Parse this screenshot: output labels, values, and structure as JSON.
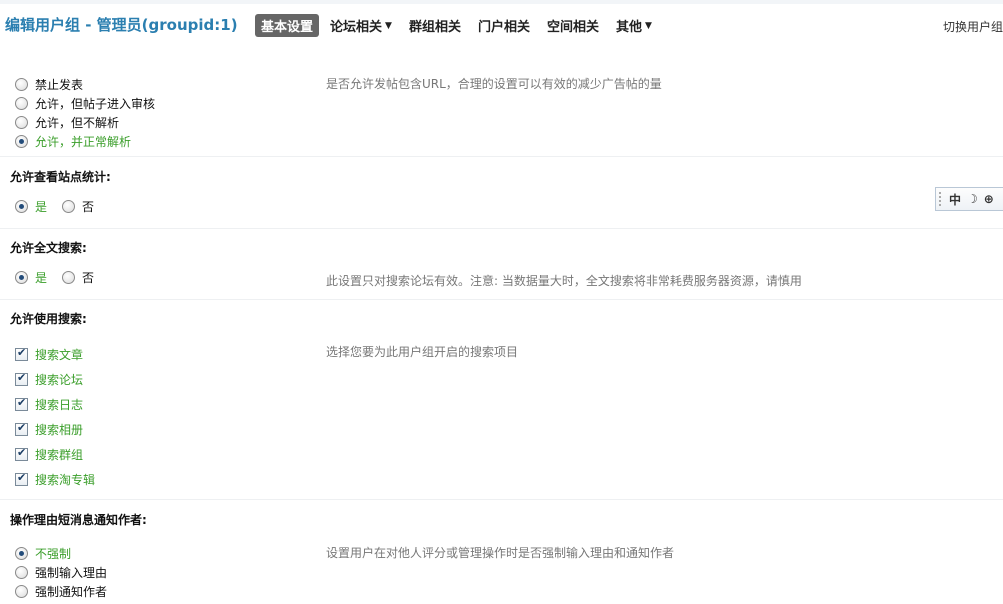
{
  "header": {
    "title": "编辑用户组 - 管理员(groupid:1)",
    "nav": [
      {
        "label": "基本设置",
        "active": true,
        "dropdown": false
      },
      {
        "label": "论坛相关",
        "active": false,
        "dropdown": true
      },
      {
        "label": "群组相关",
        "active": false,
        "dropdown": false
      },
      {
        "label": "门户相关",
        "active": false,
        "dropdown": false
      },
      {
        "label": "空间相关",
        "active": false,
        "dropdown": false
      },
      {
        "label": "其他",
        "active": false,
        "dropdown": true
      }
    ],
    "switch_group": "切换用户组"
  },
  "url_post": {
    "options": [
      "禁止发表",
      "允许，但帖子进入审核",
      "允许，但不解析",
      "允许，并正常解析"
    ],
    "selected_index": 3,
    "tip": "是否允许发帖包含URL，合理的设置可以有效的减少广告帖的量"
  },
  "view_stats": {
    "title": "允许查看站点统计:",
    "yes": "是",
    "no": "否",
    "value": "是"
  },
  "fulltext_search": {
    "title": "允许全文搜索:",
    "yes": "是",
    "no": "否",
    "value": "是",
    "tip": "此设置只对搜索论坛有效。注意: 当数据量大时，全文搜索将非常耗费服务器资源，请慎用"
  },
  "search": {
    "title": "允许使用搜索:",
    "items": [
      "搜索文章",
      "搜索论坛",
      "搜索日志",
      "搜索相册",
      "搜索群组",
      "搜索淘专辑"
    ],
    "checked": [
      true,
      true,
      true,
      true,
      true,
      true
    ],
    "tip": "选择您要为此用户组开启的搜索项目"
  },
  "notify_author": {
    "title": "操作理由短消息通知作者:",
    "options": [
      "不强制",
      "强制输入理由",
      "强制通知作者"
    ],
    "selected_index": 0,
    "tip": "设置用户在对他人评分或管理操作时是否强制输入理由和通知作者"
  },
  "ime": {
    "mode": "中",
    "moon": "☽",
    "punct": "⊕"
  }
}
